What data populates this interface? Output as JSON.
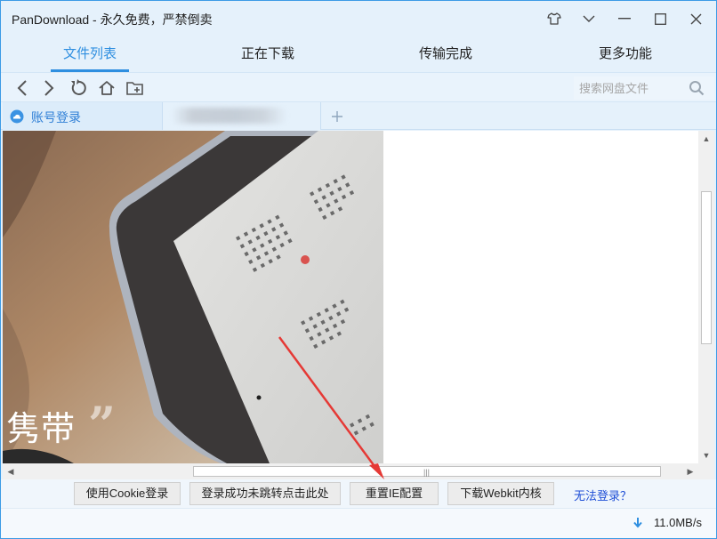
{
  "window": {
    "title": "PanDownload - 永久免费，严禁倒卖",
    "controls": [
      "skin-icon",
      "dropdown-icon",
      "minimize-icon",
      "maximize-icon",
      "close-icon"
    ]
  },
  "tabs": [
    {
      "label": "文件列表",
      "active": true
    },
    {
      "label": "正在下载",
      "active": false
    },
    {
      "label": "传输完成",
      "active": false
    },
    {
      "label": "更多功能",
      "active": false
    }
  ],
  "toolbar": {
    "icons": [
      "back-icon",
      "forward-icon",
      "refresh-icon",
      "home-icon",
      "new-folder-icon"
    ],
    "search_placeholder": "搜索网盘文件"
  },
  "browser_tabs": {
    "login_tab_label": "账号登录"
  },
  "content": {
    "caption": "隽带",
    "quote_mark": "”"
  },
  "actions": {
    "cookie_login": "使用Cookie登录",
    "redirect_fix": "登录成功未跳转点击此处",
    "reset_ie": "重置IE配置",
    "download_webkit": "下载Webkit内核",
    "cannot_login": "无法登录？"
  },
  "status": {
    "speed": "11.0MB/s"
  },
  "colors": {
    "accent": "#2f8fe0",
    "link": "#1f4fd6",
    "annotation_arrow": "#e53935",
    "window_bg": "#e5f1fb"
  }
}
